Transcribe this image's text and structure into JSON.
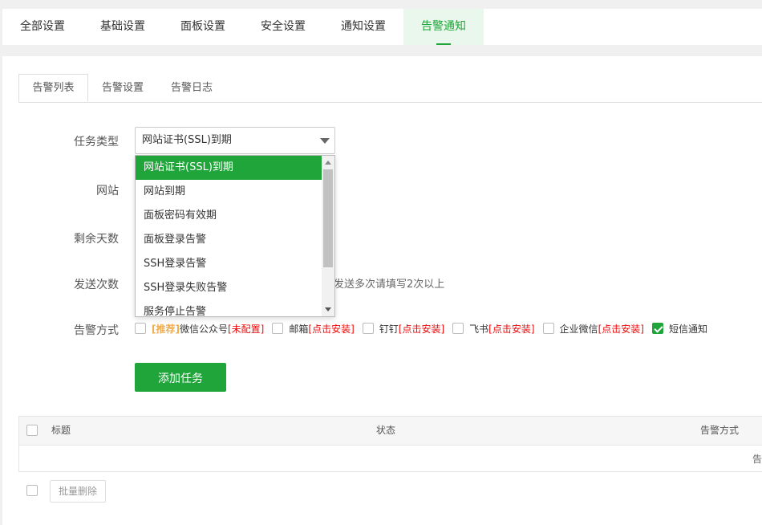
{
  "top_tabs": [
    "全部设置",
    "基础设置",
    "面板设置",
    "安全设置",
    "通知设置",
    "告警通知"
  ],
  "sub_tabs": [
    "告警列表",
    "告警设置",
    "告警日志"
  ],
  "form": {
    "task_type_label": "任务类型",
    "task_type_value": "网站证书(SSL)到期",
    "site_label": "网站",
    "days_label": "剩余天数",
    "send_count_label": "发送次数",
    "send_count_hint": "发送多次请填写2次以上",
    "method_label": "告警方式"
  },
  "dropdown_options": [
    "网站证书(SSL)到期",
    "网站到期",
    "面板密码有效期",
    "面板登录告警",
    "SSH登录告警",
    "SSH登录失败告警",
    "服务停止告警"
  ],
  "methods": [
    {
      "prefix": "[推荐]",
      "name": "微信公众号",
      "tag": "[未配置]",
      "checked": false
    },
    {
      "prefix": "",
      "name": "邮箱",
      "tag": "[点击安装]",
      "checked": false
    },
    {
      "prefix": "",
      "name": "钉钉",
      "tag": "[点击安装]",
      "checked": false
    },
    {
      "prefix": "",
      "name": "飞书",
      "tag": "[点击安装]",
      "checked": false
    },
    {
      "prefix": "",
      "name": "企业微信",
      "tag": "[点击安装]",
      "checked": false
    },
    {
      "prefix": "",
      "name": "短信通知",
      "tag": "",
      "checked": true
    }
  ],
  "add_button": "添加任务",
  "table": {
    "headers": [
      "标题",
      "状态",
      "告警方式"
    ],
    "empty_text": "告"
  },
  "batch_delete": "批量删除",
  "colors": {
    "accent": "#20a53a",
    "danger": "#ef0808",
    "recommend": "#f0ad4e"
  }
}
